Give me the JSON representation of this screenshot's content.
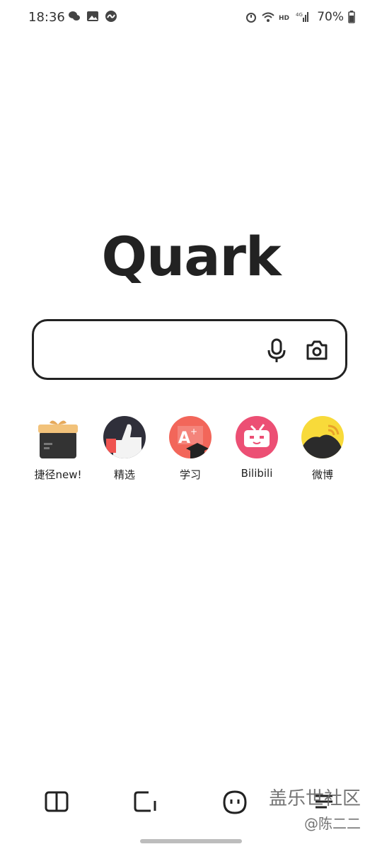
{
  "status_bar": {
    "time": "18:36",
    "battery": "70%",
    "icons_left": [
      "wechat-icon",
      "gallery-icon",
      "app-icon"
    ],
    "icons_right": [
      "alarm-icon",
      "wifi-icon",
      "hd-icon",
      "signal-4g-icon",
      "battery-icon"
    ]
  },
  "logo": {
    "text": "Quark"
  },
  "search": {
    "placeholder": "",
    "mic_icon": "microphone-icon",
    "camera_icon": "camera-icon"
  },
  "shortcuts": [
    {
      "label": "捷径new!",
      "icon": "gift-box-icon"
    },
    {
      "label": "精选",
      "icon": "thumbs-up-icon"
    },
    {
      "label": "学习",
      "icon": "learning-icon"
    },
    {
      "label": "Bilibili",
      "icon": "bilibili-icon"
    },
    {
      "label": "微博",
      "icon": "weibo-icon"
    }
  ],
  "bottom_nav": [
    {
      "icon": "book-icon"
    },
    {
      "icon": "window-icon"
    },
    {
      "icon": "chat-icon"
    },
    {
      "icon": "menu-icon"
    }
  ],
  "watermark": {
    "line1": "盖乐世社区",
    "line2": "@陈二二"
  }
}
